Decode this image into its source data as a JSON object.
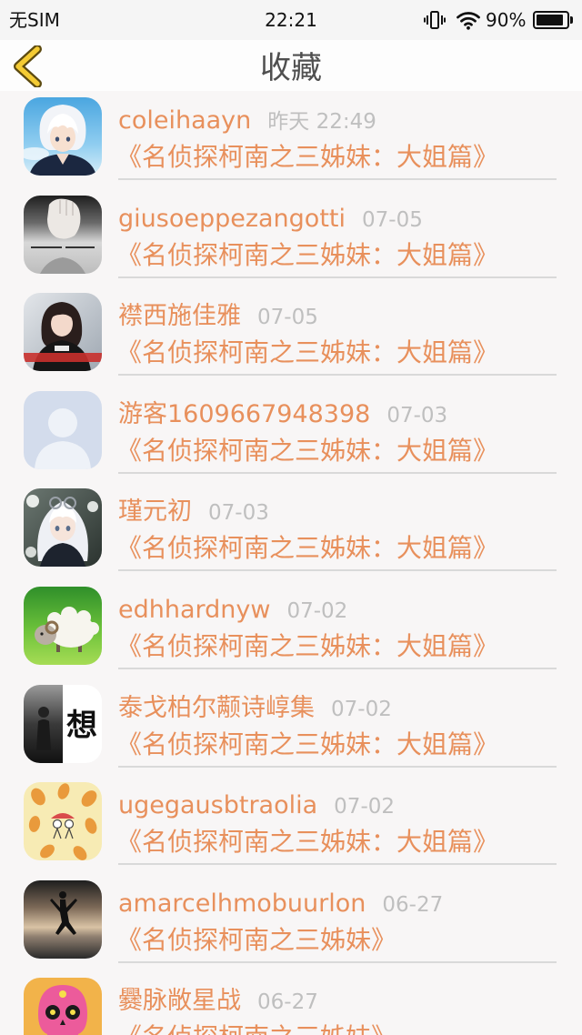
{
  "status_bar": {
    "carrier": "无SIM",
    "time": "22:21",
    "battery_text": "90%",
    "battery_level": 0.9,
    "icons": [
      "vibrate-icon",
      "wifi-icon",
      "battery-icon"
    ]
  },
  "nav": {
    "title": "收藏",
    "back_icon": "chevron-left-icon"
  },
  "colors": {
    "accent": "#e8905c",
    "timestamp": "#bfbfbf",
    "back_icon": "#f4cb34",
    "background": "#f8f6f6",
    "divider": "#d9d9d9"
  },
  "items": [
    {
      "user": "coleihaayn",
      "date": "昨天 22:49",
      "title": "《名侦探柯南之三姊妹：大姐篇》"
    },
    {
      "user": "giusoeppezangotti",
      "date": "07-05",
      "title": "《名侦探柯南之三姊妹：大姐篇》"
    },
    {
      "user": "襟西施佳雅",
      "date": "07-05",
      "title": "《名侦探柯南之三姊妹：大姐篇》"
    },
    {
      "user": "游客1609667948398",
      "date": "07-03",
      "title": "《名侦探柯南之三姊妹：大姐篇》"
    },
    {
      "user": "瑾元初",
      "date": "07-03",
      "title": "《名侦探柯南之三姊妹：大姐篇》"
    },
    {
      "user": "edhhardnyw",
      "date": "07-02",
      "title": "《名侦探柯南之三姊妹：大姐篇》"
    },
    {
      "user": "泰戈柏尔颟诗崞集",
      "date": "07-02",
      "title": "《名侦探柯南之三姊妹：大姐篇》",
      "avatar_text": "想"
    },
    {
      "user": "ugegausbtraolia",
      "date": "07-02",
      "title": "《名侦探柯南之三姊妹：大姐篇》"
    },
    {
      "user": "amarcelhmobuurlon",
      "date": "06-27",
      "title": "《名侦探柯南之三姊妹》"
    },
    {
      "user": "爨脉敞星战",
      "date": "06-27",
      "title": "《名侦探柯南之三姊妹》"
    }
  ]
}
